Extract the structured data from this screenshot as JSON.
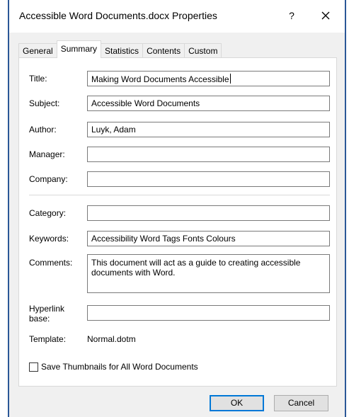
{
  "window": {
    "title": "Accessible Word Documents.docx Properties",
    "help_label": "?",
    "close_icon": "close-icon"
  },
  "tabs": [
    {
      "label": "General",
      "active": false
    },
    {
      "label": "Summary",
      "active": true
    },
    {
      "label": "Statistics",
      "active": false
    },
    {
      "label": "Contents",
      "active": false
    },
    {
      "label": "Custom",
      "active": false
    }
  ],
  "summary": {
    "title": {
      "label": "Title:",
      "value": "Making Word Documents Accessible"
    },
    "subject": {
      "label": "Subject:",
      "value": "Accessible Word Documents"
    },
    "author": {
      "label": "Author:",
      "value": "Luyk, Adam"
    },
    "manager": {
      "label": "Manager:",
      "value": ""
    },
    "company": {
      "label": "Company:",
      "value": ""
    },
    "category": {
      "label": "Category:",
      "value": ""
    },
    "keywords": {
      "label": "Keywords:",
      "value": "Accessibility Word Tags Fonts Colours"
    },
    "comments": {
      "label": "Comments:",
      "value": "This document will act as a guide to creating accessible documents with Word."
    },
    "hyperlink_base": {
      "label_line1": "Hyperlink",
      "label_line2": "base:",
      "value": ""
    },
    "template": {
      "label": "Template:",
      "value": "Normal.dotm"
    },
    "save_thumbnails": {
      "label": "Save Thumbnails for All Word Documents",
      "checked": false
    }
  },
  "buttons": {
    "ok": "OK",
    "cancel": "Cancel"
  }
}
